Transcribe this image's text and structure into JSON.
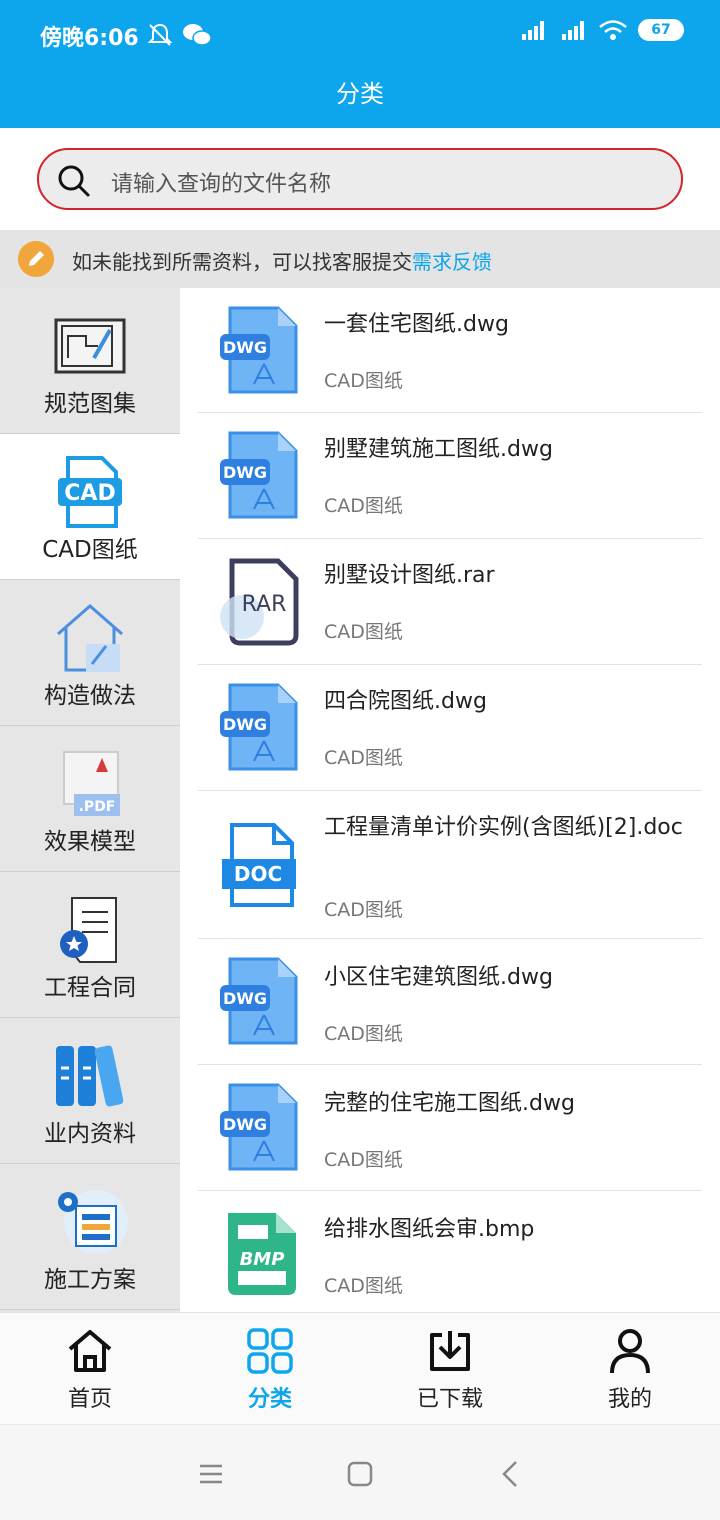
{
  "status_bar": {
    "time": "傍晚6:06",
    "battery": "67",
    "left_icons": [
      "bell-off-icon",
      "wechat-icon"
    ],
    "right_icons": [
      "signal-hd-icon",
      "signal-hd-icon",
      "wifi-icon",
      "battery-icon"
    ]
  },
  "header": {
    "title": "分类"
  },
  "search": {
    "placeholder": "请输入查询的文件名称"
  },
  "notice": {
    "text": "如未能找到所需资料，可以找客服提交",
    "link": "需求反馈"
  },
  "sidebar": {
    "items": [
      {
        "label": "规范图集",
        "icon": "blueprint-icon",
        "active": false
      },
      {
        "label": "CAD图纸",
        "icon": "cad-file-icon",
        "active": true
      },
      {
        "label": "构造做法",
        "icon": "house-icon",
        "active": false
      },
      {
        "label": "效果模型",
        "icon": "pdf-file-icon",
        "active": false
      },
      {
        "label": "工程合同",
        "icon": "contract-icon",
        "active": false
      },
      {
        "label": "业内资料",
        "icon": "books-icon",
        "active": false
      },
      {
        "label": "施工方案",
        "icon": "plan-gear-icon",
        "active": false
      }
    ]
  },
  "files": [
    {
      "name": "一套住宅图纸.dwg",
      "type": "CAD图纸",
      "icon": "dwg-file-icon"
    },
    {
      "name": "别墅建筑施工图纸.dwg",
      "type": "CAD图纸",
      "icon": "dwg-file-icon"
    },
    {
      "name": "别墅设计图纸.rar",
      "type": "CAD图纸",
      "icon": "rar-file-icon"
    },
    {
      "name": "四合院图纸.dwg",
      "type": "CAD图纸",
      "icon": "dwg-file-icon"
    },
    {
      "name": "工程量清单计价实例(含图纸)[2].doc",
      "type": "CAD图纸",
      "icon": "doc-file-icon"
    },
    {
      "name": "小区住宅建筑图纸.dwg",
      "type": "CAD图纸",
      "icon": "dwg-file-icon"
    },
    {
      "name": "完整的住宅施工图纸.dwg",
      "type": "CAD图纸",
      "icon": "dwg-file-icon"
    },
    {
      "name": "给排水图纸会审.bmp",
      "type": "CAD图纸",
      "icon": "bmp-file-icon"
    }
  ],
  "file_badges": {
    "dwg": "DWG",
    "rar": "RAR",
    "doc": "DOC",
    "bmp": "BMP",
    "cad": "CAD",
    "pdf": ".PDF"
  },
  "bottom_nav": [
    {
      "label": "首页",
      "icon": "home-icon",
      "active": false
    },
    {
      "label": "分类",
      "icon": "grid-icon",
      "active": true
    },
    {
      "label": "已下载",
      "icon": "download-icon",
      "active": false
    },
    {
      "label": "我的",
      "icon": "user-icon",
      "active": false
    }
  ],
  "colors": {
    "primary": "#0da6ec",
    "search_border": "#d2242b",
    "dwg": "#5aa7f2",
    "bmp": "#2fb58a",
    "rar": "#3b3f5c",
    "notice_icon": "#f0a63a"
  }
}
